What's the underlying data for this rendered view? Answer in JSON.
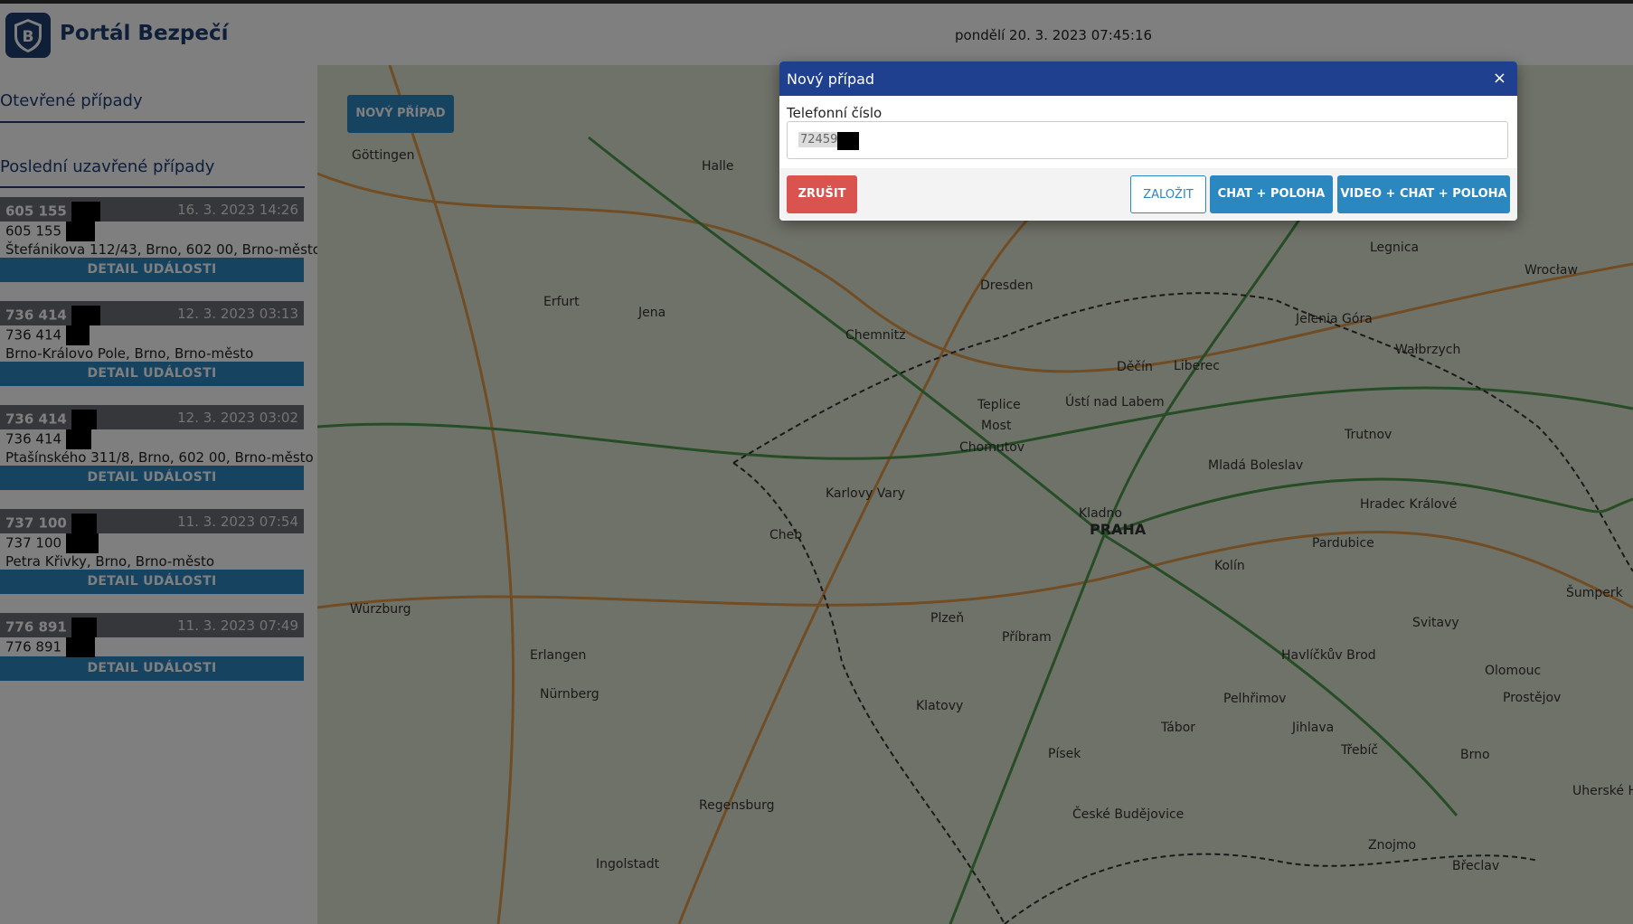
{
  "header": {
    "brand": "Portál Bezpečí",
    "datetime": "pondělí 20. 3. 2023 07:45:16"
  },
  "sidebar": {
    "open_cases_title": "Otevřené případy",
    "closed_cases_title": "Poslední uzavřené případy",
    "cases": [
      {
        "number": "605 155",
        "date": "16. 3. 2023 14:26",
        "phone": "605 155",
        "address": "Štefánikova 112/43, Brno, 602 00, Brno-město",
        "detail_label": "DETAIL UDÁLOSTI"
      },
      {
        "number": "736 414",
        "date": "12. 3. 2023 03:13",
        "phone": "736 414",
        "address": "Brno-Královo Pole, Brno, Brno-město",
        "detail_label": "DETAIL UDÁLOSTI"
      },
      {
        "number": "736 414",
        "date": "12. 3. 2023 03:02",
        "phone": "736 414",
        "address": "Ptašínského 311/8, Brno, 602 00, Brno-město",
        "detail_label": "DETAIL UDÁLOSTI"
      },
      {
        "number": "737 100",
        "date": "11. 3. 2023 07:54",
        "phone": "737 100",
        "address": "Petra Křivky, Brno, Brno-město",
        "detail_label": "DETAIL UDÁLOSTI"
      },
      {
        "number": "776 891",
        "date": "11. 3. 2023 07:49",
        "phone": "776 891",
        "address": "",
        "detail_label": "DETAIL UDÁLOSTI"
      }
    ]
  },
  "map": {
    "new_case_label": "NOVÝ PŘÍPAD",
    "cities": [
      "Göttingen",
      "Halle",
      "Erfurt",
      "Jena",
      "Dresden",
      "Chemnitz",
      "Legnica",
      "Wrocław",
      "Jelenia Góra",
      "Wałbrzych",
      "Děčín",
      "Liberec",
      "Ústí nad Labem",
      "Teplice",
      "Most",
      "Chomutov",
      "Karlovy Vary",
      "Cheb",
      "Kladno",
      "PRAHA",
      "Mladá Boleslav",
      "Hradec Králové",
      "Pardubice",
      "Trutnov",
      "Kolín",
      "Würzburg",
      "Plzeň",
      "Příbram",
      "Erlangen",
      "Nürnberg",
      "Klatovy",
      "Tábor",
      "Písek",
      "Jihlava",
      "Pelhřimov",
      "Havlíčkův Brod",
      "Šumperk",
      "Svitavy",
      "Olomouc",
      "Prostějov",
      "Třebíč",
      "Brno",
      "Regensburg",
      "České Budějovice",
      "Ingolstadt",
      "Znojmo",
      "Břeclav",
      "Uherské H"
    ]
  },
  "modal": {
    "title": "Nový případ",
    "close": "×",
    "field_label": "Telefonní číslo",
    "phone_value": "724590",
    "cancel_label": "ZRUŠIT",
    "create_label": "ZALOŽIT",
    "chat_label": "CHAT + POLOHA",
    "video_label": "VIDEO + CHAT + POLOHA"
  },
  "colors": {
    "brand": "#1d3f6e",
    "modal_header": "#1f3f8f",
    "primary": "#2b87c0",
    "danger": "#d9534f"
  }
}
